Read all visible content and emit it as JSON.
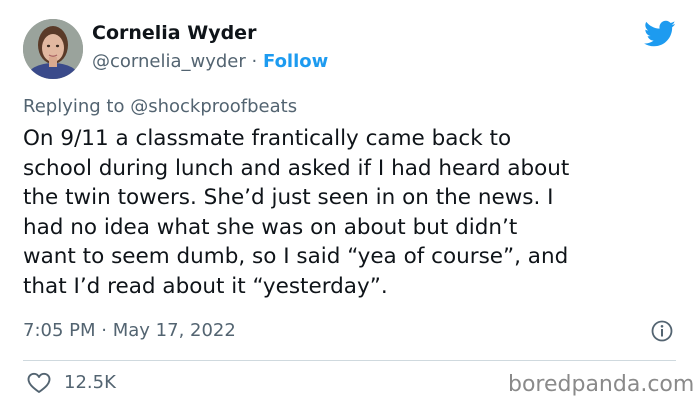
{
  "author": {
    "name": "Cornelia Wyder",
    "handle": "@cornelia_wyder",
    "separator": "·",
    "follow_label": "Follow"
  },
  "reply": {
    "prefix": "Replying to",
    "mention": "@shockproofbeats"
  },
  "body_lines": [
    "On 9/11 a classmate frantically came back to",
    "school during lunch and asked if I had heard about",
    "the twin towers. She’d just seen in on the news. I",
    "had no idea what she was on about but didn’t",
    "want to seem dumb, so I said “yea of course”, and",
    "that I’d read about it “yesterday”."
  ],
  "meta": {
    "time": "7:05 PM",
    "separator": "·",
    "date": "May 17, 2022"
  },
  "actions": {
    "likes": "12.5K"
  },
  "watermark": "boredpanda.com",
  "colors": {
    "accent": "#1d9bf0",
    "muted": "#536471",
    "text": "#0f1419"
  }
}
